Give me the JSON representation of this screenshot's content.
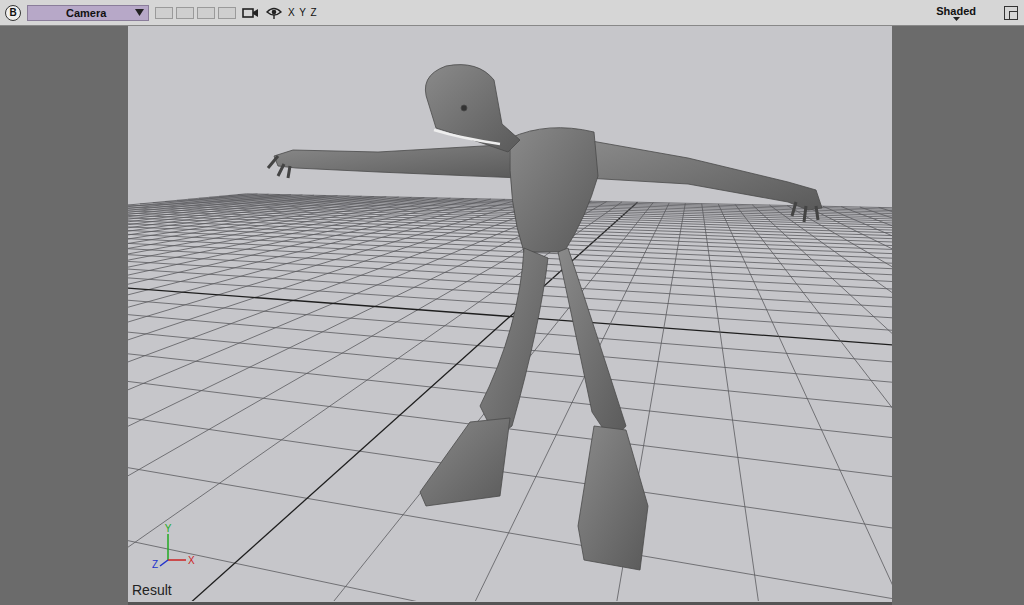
{
  "toolbar": {
    "menu_button": "B",
    "camera": "Camera",
    "axes": "X Y Z",
    "shading": "Shaded"
  },
  "viewport": {
    "label": "Result",
    "gizmo": {
      "x": "X",
      "y": "Y",
      "z": "Z"
    }
  }
}
